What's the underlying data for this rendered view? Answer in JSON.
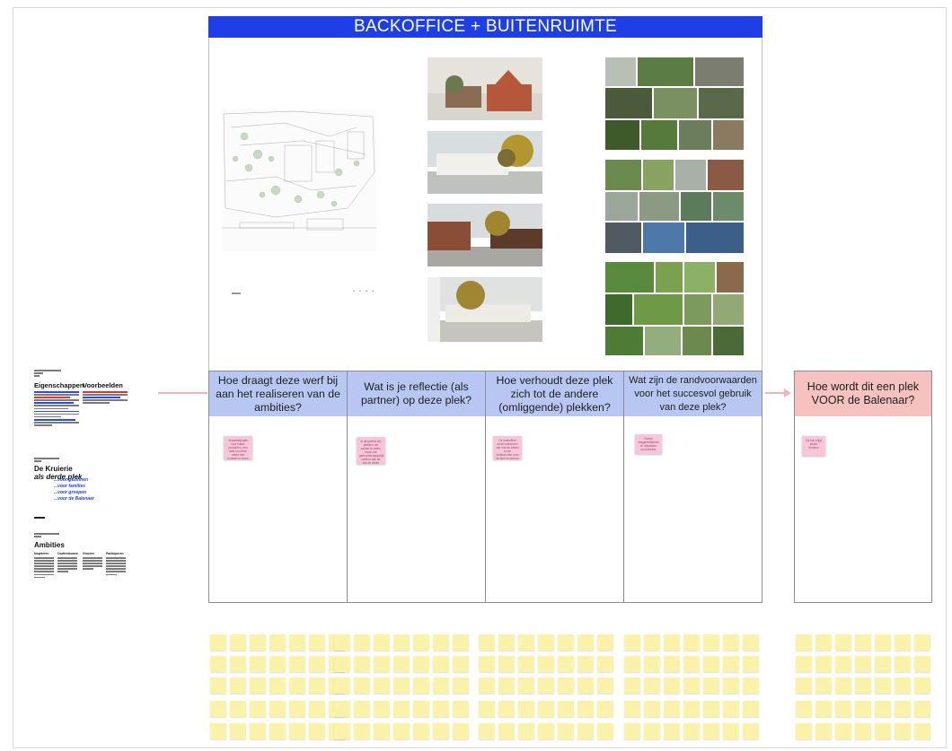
{
  "board": {
    "title": "BACKOFFICE + BUITENRUIMTE",
    "accent_color": "#1f3fe6"
  },
  "columns": [
    {
      "header": "Hoe draagt deze werf bij aan het realiseren van de ambities?",
      "note": "Verzamelplaats voor lokale producten, een tafel en kleine markt met bouwen in groep"
    },
    {
      "header": "Wat is je reflectie (als partner) op deze plek?",
      "note": "In dit gebied zijn plekken om samen te zitten, maar ook gemeenschappelijk werken aan de tuin en groen"
    },
    {
      "header": "Hoe verhoudt deze plek zich tot de andere (omliggende) plekken?",
      "note": "De backoffice moet verbonden zijn met de tuinen en de buitenruimte rond de kerk en school"
    },
    {
      "header": "Wat zijn de randvoorwaarden voor het succesvol gebruik van deze plek?",
      "note": "Goede toegankelijkheid en afspraken rond beheer"
    }
  ],
  "final_column": {
    "header": "Hoe wordt dit een plek VOOR de Balenaar?",
    "note": "De tuin krijgt lokale functies"
  },
  "left_panel": {
    "heading_properties": "Eigenschappen",
    "heading_examples": "Voorbeelden",
    "kruierie_title": "De Kruierie",
    "kruierie_subtitle": "als derde plek",
    "kruierie_lines": [
      "...voor gezinnen",
      "...voor families",
      "...voor groepen",
      "...voor de Balenaar"
    ],
    "ambities_title": "Ambities",
    "ambities_cols": [
      "Inspireren",
      "Ondersteunen",
      "Groeien",
      "Participeren"
    ]
  },
  "colors": {
    "header_blue": "#b7c7f1",
    "header_red": "#f6c2c0",
    "sticky_pink": "#f7c6d9",
    "sticky_yellow": "#fbf2a9"
  }
}
